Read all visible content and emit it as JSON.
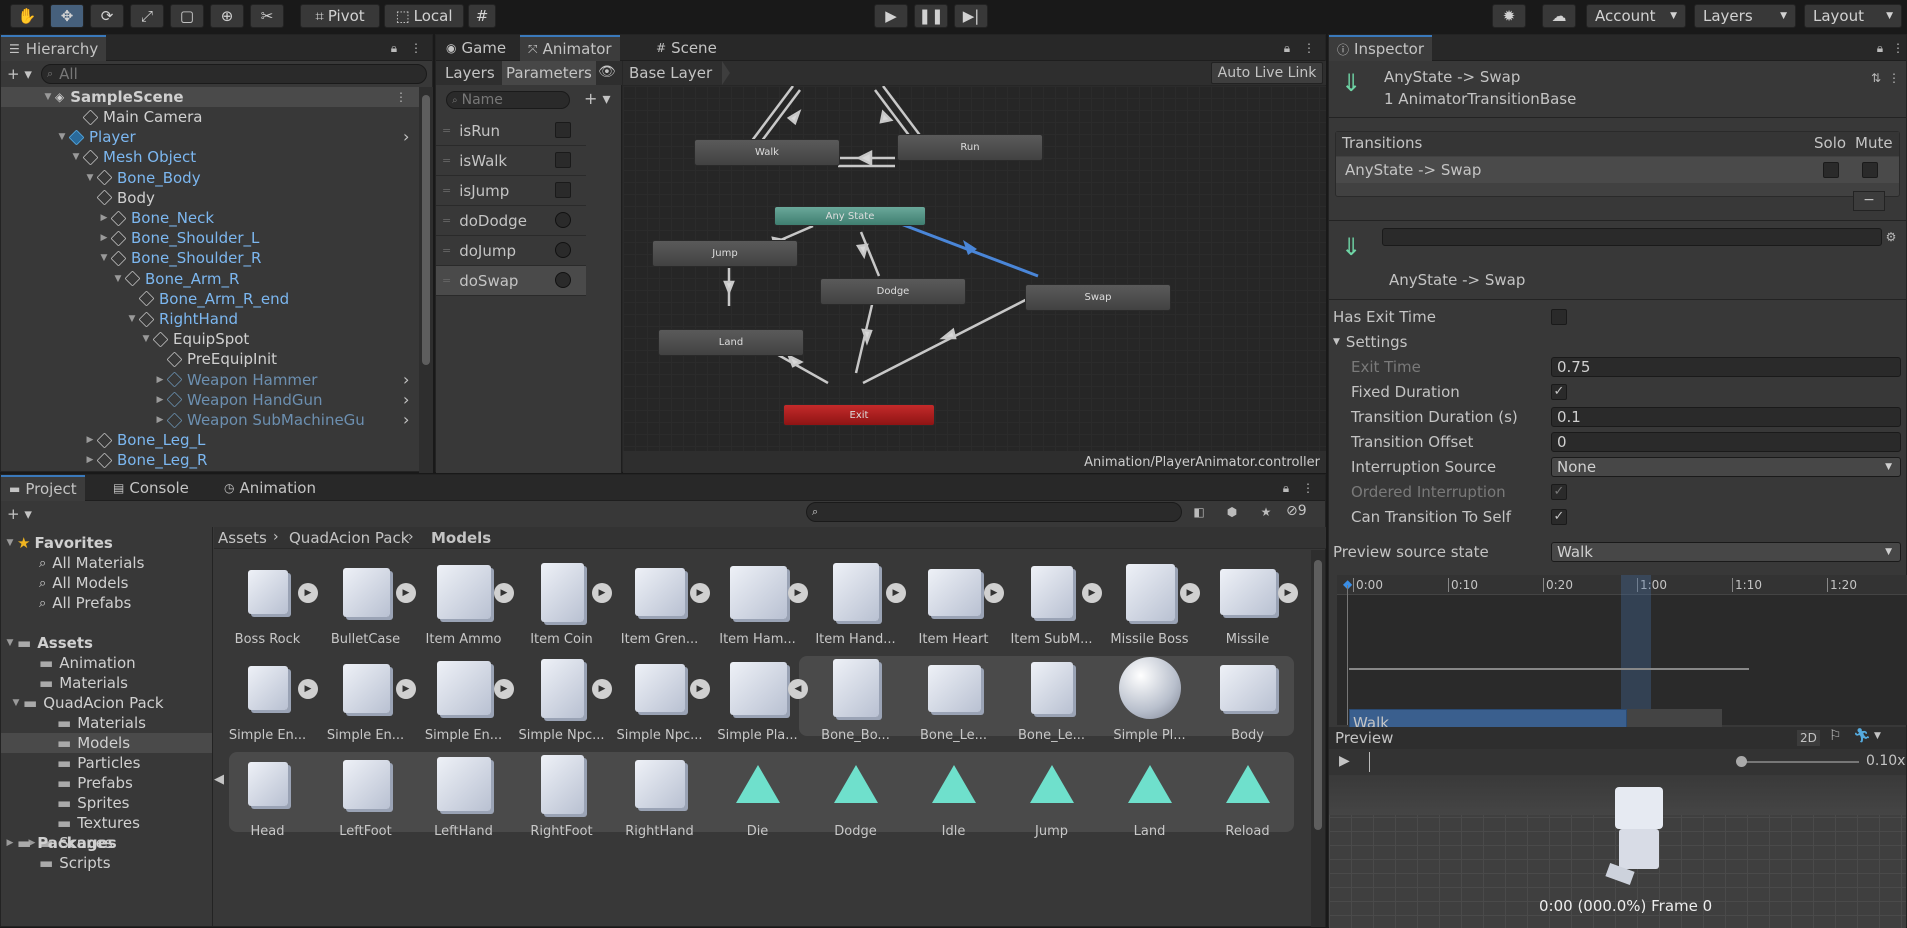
{
  "toolbar": {
    "pivot": "Pivot",
    "local": "Local",
    "account": "Account",
    "layers": "Layers",
    "layout": "Layout"
  },
  "hierarchy": {
    "title": "Hierarchy",
    "search_placeholder": "All",
    "scene": "SampleScene",
    "items": [
      {
        "label": "Main Camera"
      },
      {
        "label": "Player"
      },
      {
        "label": "Mesh Object"
      },
      {
        "label": "Bone_Body"
      },
      {
        "label": "Body"
      },
      {
        "label": "Bone_Neck"
      },
      {
        "label": "Bone_Shoulder_L"
      },
      {
        "label": "Bone_Shoulder_R"
      },
      {
        "label": "Bone_Arm_R"
      },
      {
        "label": "Bone_Arm_R_end"
      },
      {
        "label": "RightHand"
      },
      {
        "label": "EquipSpot"
      },
      {
        "label": "PreEquipInit"
      },
      {
        "label": "Weapon Hammer"
      },
      {
        "label": "Weapon HandGun"
      },
      {
        "label": "Weapon SubMachineGu"
      },
      {
        "label": "Bone_Leg_L"
      },
      {
        "label": "Bone_Leg_R"
      }
    ]
  },
  "animator": {
    "tabs": [
      "Game",
      "Animator",
      "Scene"
    ],
    "layers_tab": "Layers",
    "parameters_tab": "Parameters",
    "name_placeholder": "Name",
    "base_layer": "Base Layer",
    "auto_live_link": "Auto Live Link",
    "path": "Animation/PlayerAnimator.controller",
    "parameters": [
      {
        "name": "isRun"
      },
      {
        "name": "isWalk"
      },
      {
        "name": "isJump"
      },
      {
        "name": "doDodge"
      },
      {
        "name": "doJump"
      },
      {
        "name": "doSwap"
      }
    ],
    "states": [
      "Walk",
      "Run",
      "Any State",
      "Jump",
      "Dodge",
      "Swap",
      "Land",
      "Exit"
    ]
  },
  "project": {
    "tabs": [
      "Project",
      "Console",
      "Animation"
    ],
    "hidden_count": "9",
    "favorites": "Favorites",
    "fav_items": [
      "All Materials",
      "All Models",
      "All Prefabs"
    ],
    "assets": "Assets",
    "asset_folders": [
      "Animation",
      "Materials",
      "QuadAcion Pack",
      "Materials",
      "Models",
      "Particles",
      "Prefabs",
      "Sprites",
      "Textures",
      "Scenes",
      "Scripts"
    ],
    "packages": "Packages",
    "breadcrumb": [
      "Assets",
      "QuadAcion Pack",
      "Models"
    ],
    "row1": [
      "Boss Rock",
      "BulletCase",
      "Item Ammo",
      "Item Coin",
      "Item Gren...",
      "Item Ham...",
      "Item Hand...",
      "Item Heart",
      "Item SubM...",
      "Missile Boss",
      "Missile"
    ],
    "row2": [
      "Simple En...",
      "Simple En...",
      "Simple En...",
      "Simple Npc...",
      "Simple Npc...",
      "Simple Pla...",
      "Bone_Bo...",
      "Bone_Le...",
      "Bone_Le...",
      "Simple Pl...",
      "Body"
    ],
    "row3": [
      "Head",
      "LeftFoot",
      "LeftHand",
      "RightFoot",
      "RightHand",
      "Die",
      "Dodge",
      "Idle",
      "Jump",
      "Land",
      "Reload"
    ]
  },
  "inspector": {
    "title": "Inspector",
    "header_name": "AnyState -> Swap",
    "header_type": "1 AnimatorTransitionBase",
    "transitions_label": "Transitions",
    "solo": "Solo",
    "mute": "Mute",
    "transition_row": "AnyState -> Swap",
    "sub_name": "AnyState -> Swap",
    "has_exit_time": "Has Exit Time",
    "settings": "Settings",
    "exit_time": "Exit Time",
    "exit_time_val": "0.75",
    "fixed_duration": "Fixed Duration",
    "transition_duration": "Transition Duration (s)",
    "transition_duration_val": "0.1",
    "transition_offset": "Transition Offset",
    "transition_offset_val": "0",
    "interruption_source": "Interruption Source",
    "interruption_source_val": "None",
    "ordered_interruption": "Ordered Interruption",
    "can_transition": "Can Transition To Self",
    "preview_source": "Preview source state",
    "preview_source_val": "Walk",
    "timeline_labels": [
      "0:00",
      "0:10",
      "0:20",
      "1:00",
      "1:10",
      "1:20"
    ],
    "clip": "Walk",
    "preview": "Preview",
    "mode_2d": "2D",
    "speed": "0.10x",
    "frame_text": "0:00 (000.0%) Frame 0"
  }
}
